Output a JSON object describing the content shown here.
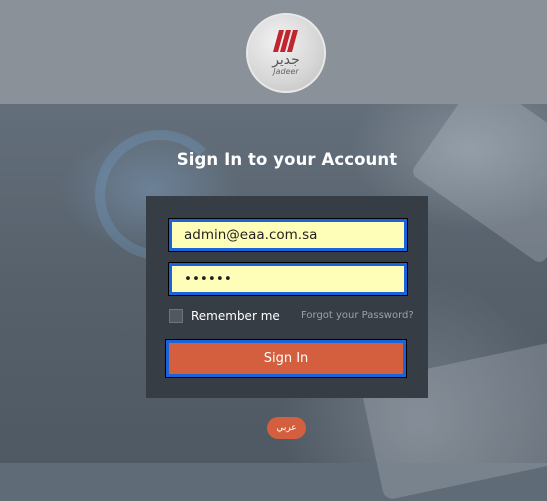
{
  "header": {
    "logo_arabic": "جدير",
    "logo_english": "Jadeer"
  },
  "login": {
    "title": "Sign In to your Account",
    "email_value": "admin@eaa.com.sa",
    "password_value": "••••••",
    "remember_label": "Remember me",
    "forgot_label": "Forgot your Password?",
    "signin_label": "Sign In"
  },
  "language": {
    "toggle_label": "عربي"
  },
  "colors": {
    "header_bg": "#8a9199",
    "panel_bg": "#363d45",
    "input_bg": "#fffeb8",
    "focus_border": "#1a64d8",
    "accent": "#d45f3f"
  }
}
